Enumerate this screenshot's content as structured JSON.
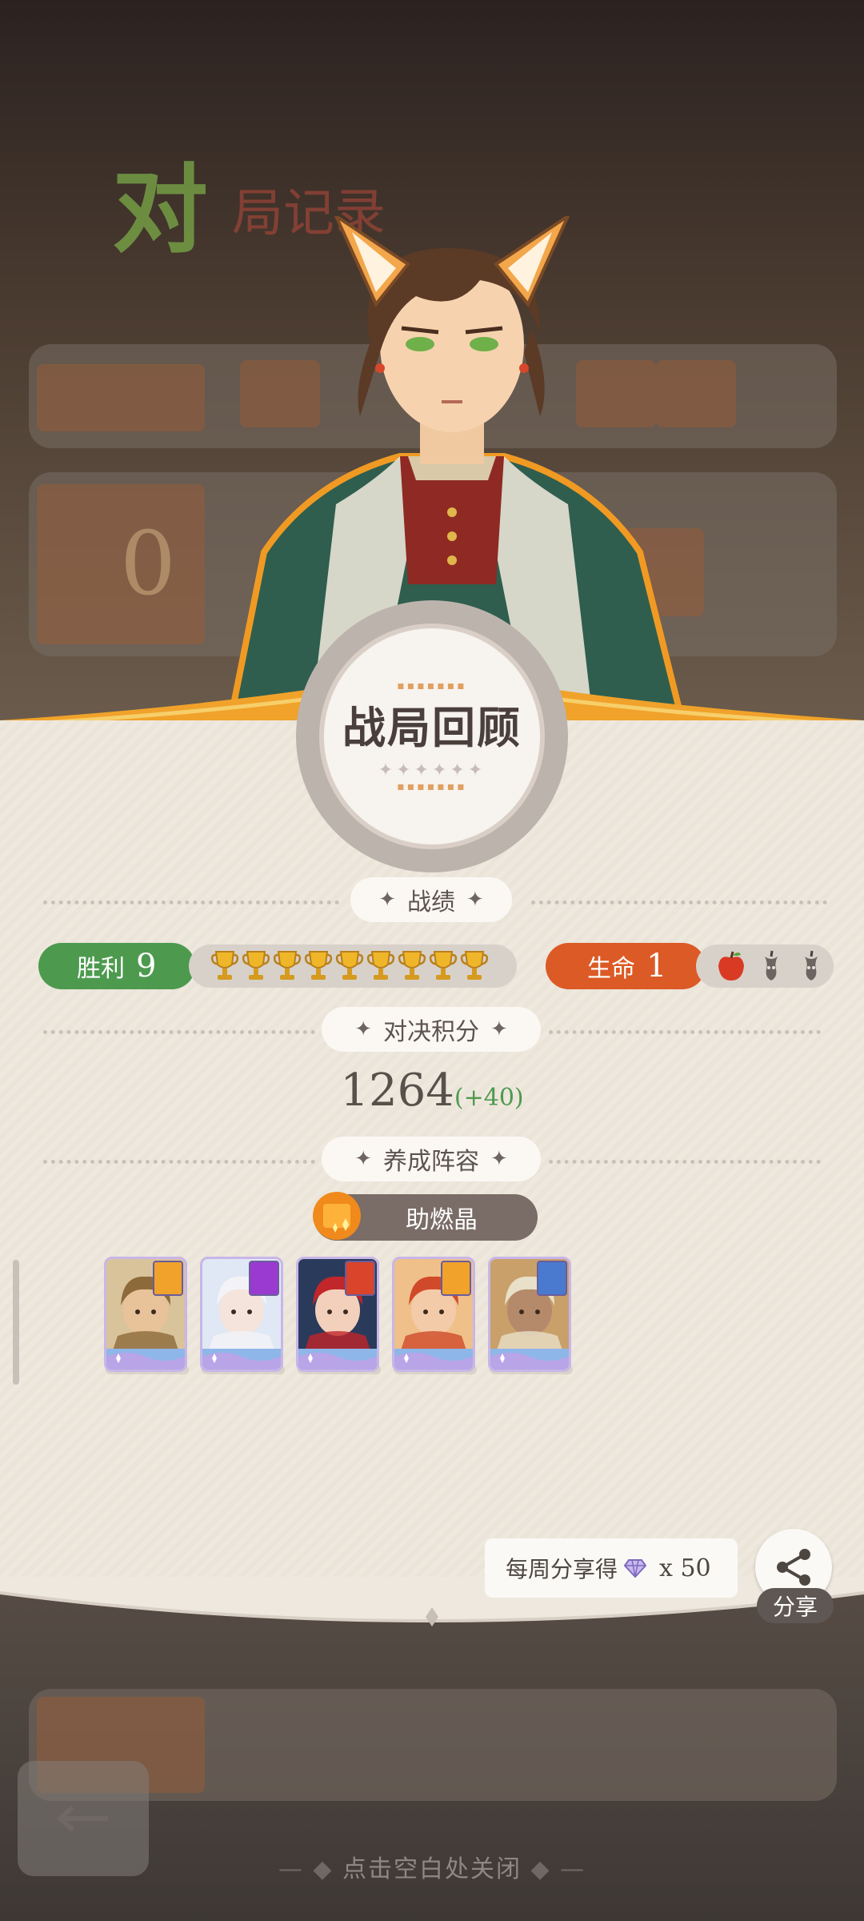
{
  "background": {
    "title_char": "对",
    "title_rest": "局记录",
    "card_score": "0"
  },
  "review": {
    "title": "战局回顾",
    "sections": {
      "record": "战绩",
      "score": "对决积分",
      "lineup": "养成阵容"
    },
    "wins": {
      "label": "胜利",
      "value": "9",
      "trophies": 9
    },
    "lives": {
      "label": "生命",
      "value": "1",
      "full": 1,
      "empty": 2
    },
    "score": {
      "value": "1264",
      "delta": "(+40)"
    },
    "crystal": {
      "label": "助燃晶"
    },
    "heroes": [
      {
        "name": "hero-dwarf",
        "tag": "gold"
      },
      {
        "name": "hero-snow-mage",
        "tag": "purple"
      },
      {
        "name": "hero-witch",
        "tag": "red"
      },
      {
        "name": "hero-redhead",
        "tag": "gold"
      },
      {
        "name": "hero-brute",
        "tag": "blue"
      }
    ]
  },
  "share": {
    "reward_text": "每周分享得",
    "reward_mult": "x 50",
    "button_label": "分享"
  },
  "footer": {
    "close_hint": "点击空白处关闭"
  },
  "colors": {
    "win": "#4d9a4e",
    "life": "#dc5a26",
    "accent_gold": "#f0a22a",
    "panel": "#efe8de"
  }
}
